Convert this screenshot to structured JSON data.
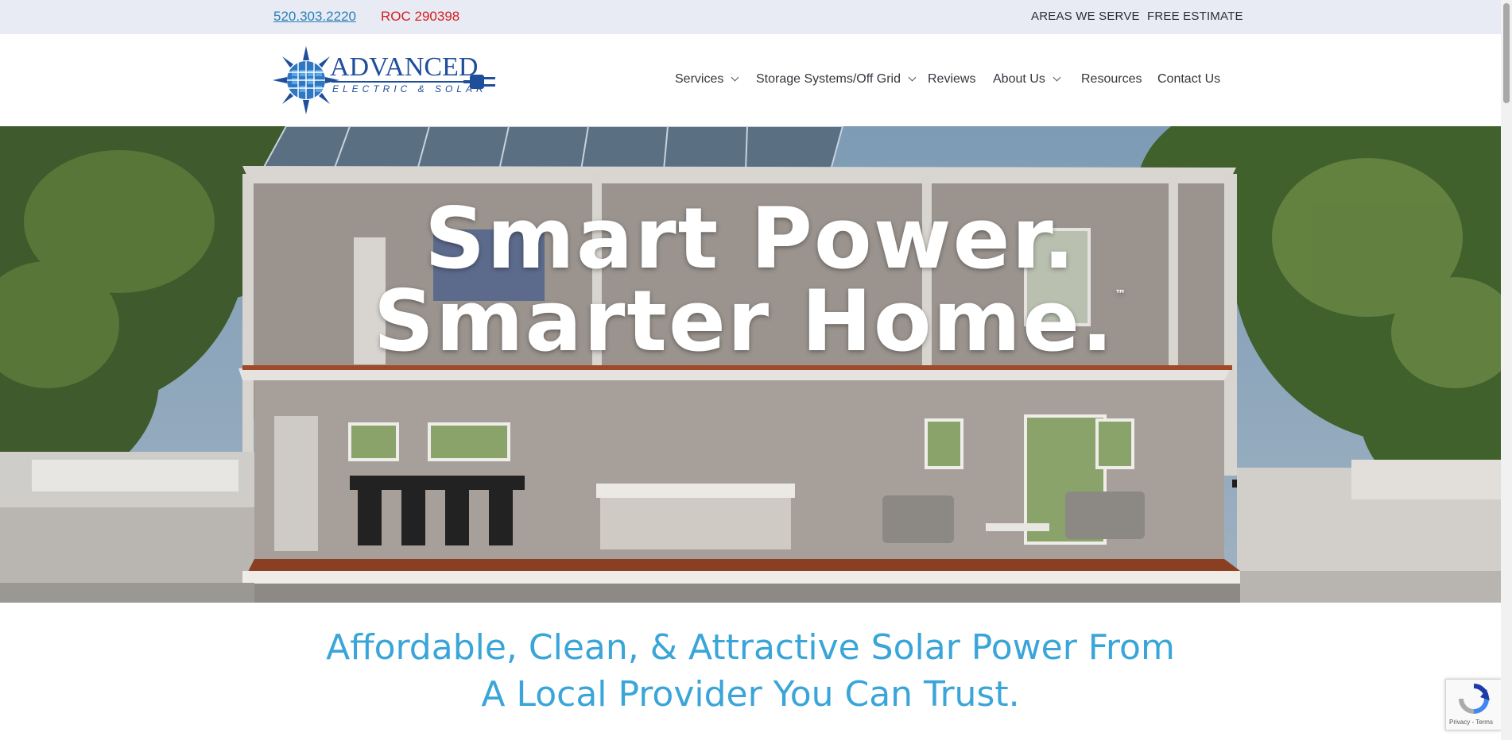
{
  "topbar": {
    "phone": "520.303.2220",
    "roc": "ROC 290398",
    "areas": "AREAS WE SERVE",
    "estimate": "FREE ESTIMATE"
  },
  "logo": {
    "name": "ADVANCED",
    "tagline": "ELECTRIC & SOLAR"
  },
  "nav": {
    "services": "Services",
    "storage": "Storage Systems/Off Grid",
    "reviews": "Reviews",
    "about": "About Us",
    "resources": "Resources",
    "contact": "Contact Us"
  },
  "hero": {
    "line1": "Smart Power.",
    "line2": "Smarter Home.",
    "trademark": "™"
  },
  "headline": {
    "line1": "Affordable, Clean, & Attractive Solar Power From",
    "line2": "A Local Provider You Can Trust."
  },
  "recaptcha": {
    "terms": "Privacy - Terms"
  },
  "colors": {
    "brand_blue": "#1f4e9a",
    "headline_blue": "#3aa5d8",
    "roc_red": "#d21f1f",
    "topbar_bg": "#e8ebf3"
  }
}
